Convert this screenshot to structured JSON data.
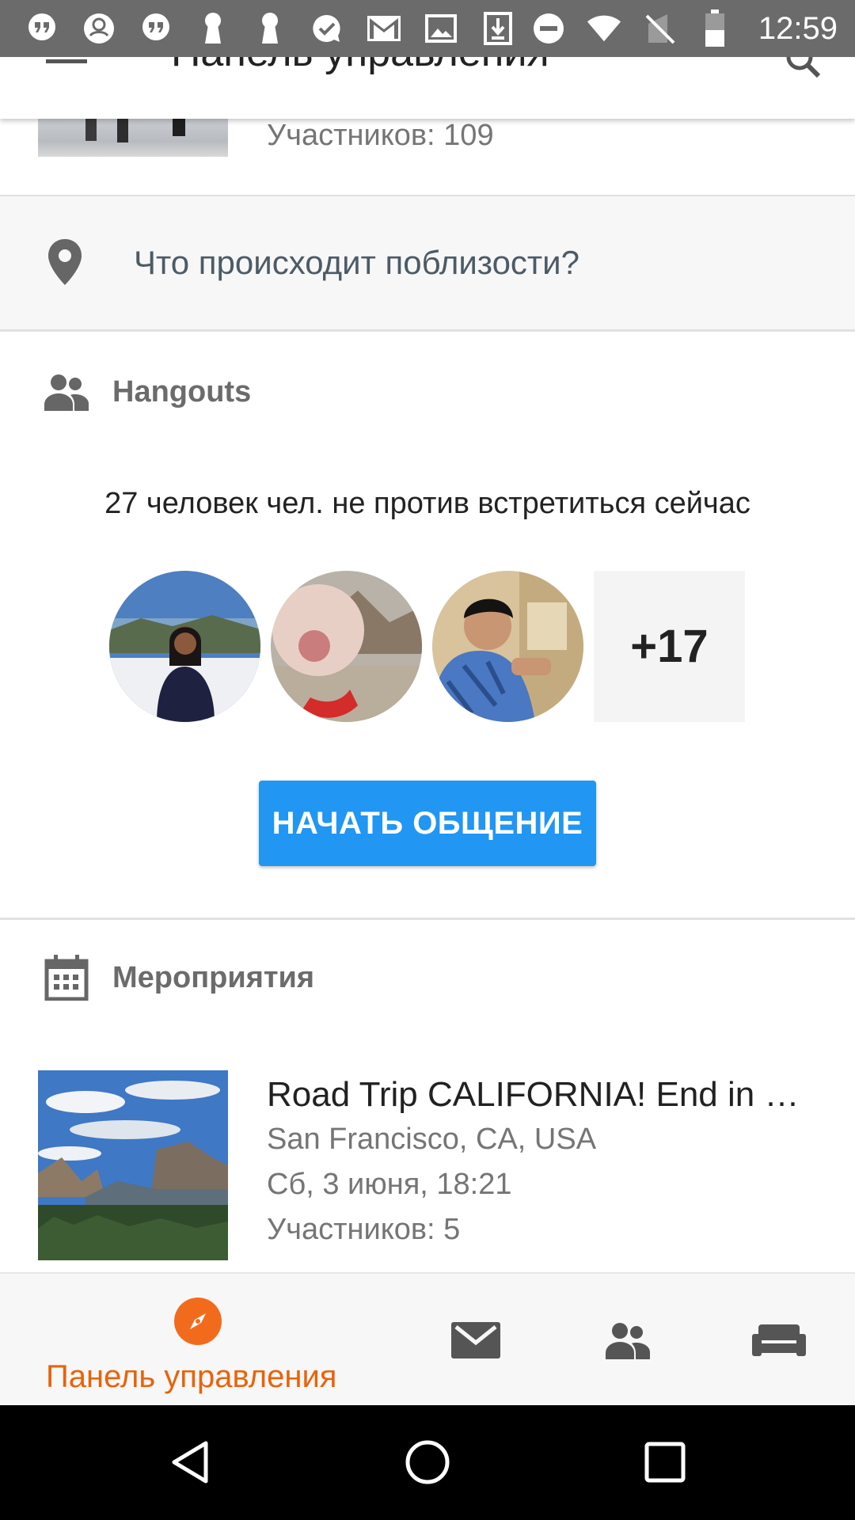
{
  "status_bar": {
    "time": "12:59",
    "icons": [
      "hangouts-quote-icon",
      "app-icon",
      "hangouts-quote-icon",
      "keyhole-icon",
      "keyhole-icon",
      "check-bubble-icon",
      "gmail-icon",
      "image-icon",
      "download-icon",
      "do-not-disturb-icon",
      "wifi-icon",
      "no-sim-icon",
      "battery-icon"
    ]
  },
  "app_bar": {
    "title": "Панель управления"
  },
  "previous_item": {
    "participants": "Участников: 109"
  },
  "nearby": {
    "text": "Что происходит поблизости?"
  },
  "hangouts": {
    "header": "Hangouts",
    "subtitle": "27 человек чел. не против встретиться сейчас",
    "more_count": "+17",
    "start_button": "НАЧАТЬ ОБЩЕНИЕ"
  },
  "events": {
    "header": "Мероприятия",
    "items": [
      {
        "title": "Road Trip CALIFORNIA! End in …",
        "location": "San Francisco, CA, USA",
        "date": "Сб, 3 июня, 18:21",
        "participants": "Участников: 5"
      }
    ]
  },
  "bottom_nav": {
    "active_label": "Панель управления",
    "accent_color": "#e8630a"
  },
  "colors": {
    "primary_button": "#2196f3",
    "status_bar": "#6b6b6b"
  }
}
